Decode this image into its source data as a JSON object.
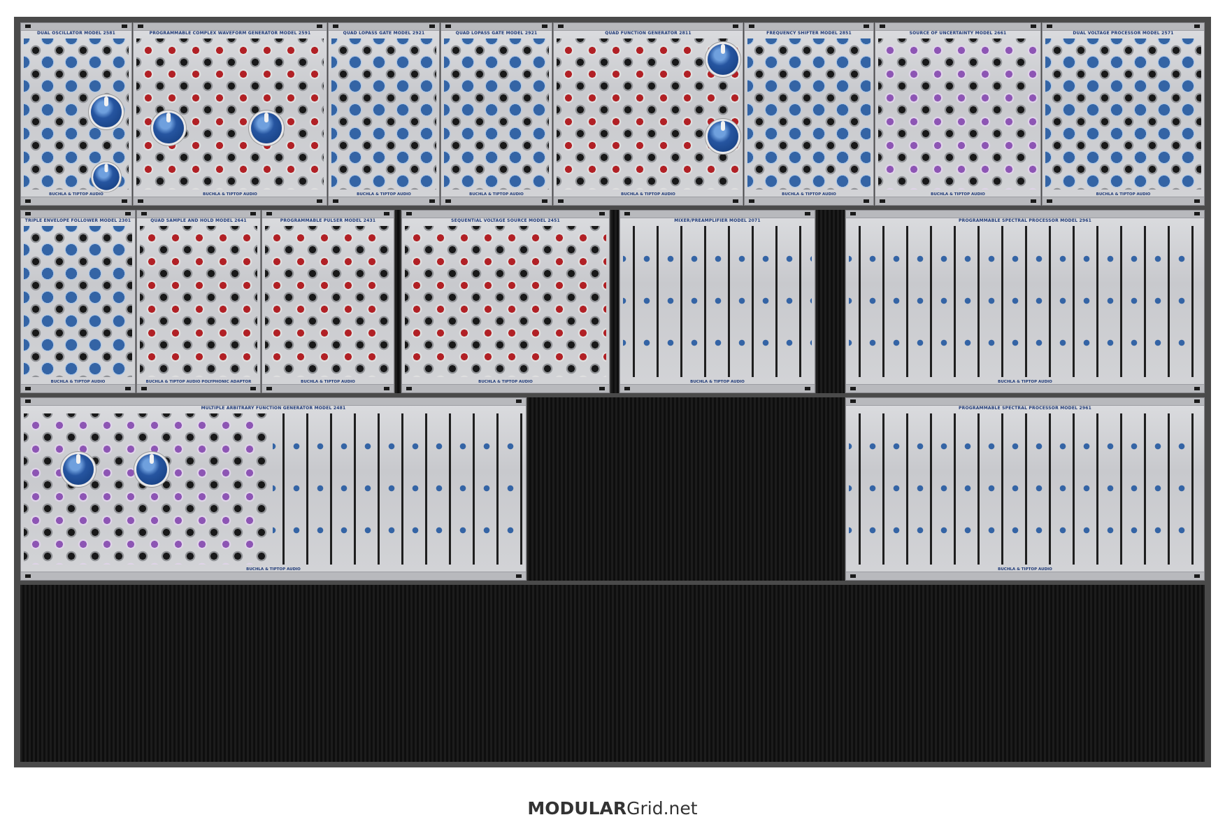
{
  "footer": {
    "brand_bold": "MODULAR",
    "brand_regular": "Grid.net"
  },
  "rows": [
    {
      "modules": [
        {
          "title": "DUAL OSCILLATOR MODEL 2581",
          "maker": "BUCHLA & TIPTOP AUDIO"
        },
        {
          "title": "PROGRAMMABLE COMPLEX WAVEFORM GENERATOR MODEL 2591",
          "maker": "BUCHLA & TIPTOP AUDIO"
        },
        {
          "title": "QUAD LOPASS GATE MODEL 2921",
          "maker": "BUCHLA & TIPTOP AUDIO"
        },
        {
          "title": "QUAD LOPASS GATE MODEL 2921",
          "maker": "BUCHLA & TIPTOP AUDIO"
        },
        {
          "title": "QUAD FUNCTION GENERATOR 2811",
          "maker": "BUCHLA & TIPTOP AUDIO"
        },
        {
          "title": "FREQUENCY SHIFTER MODEL 2851",
          "maker": "BUCHLA & TIPTOP AUDIO"
        },
        {
          "title": "SOURCE OF UNCERTAINTY MODEL 2661",
          "maker": "BUCHLA & TIPTOP AUDIO"
        },
        {
          "title": "DUAL VOLTAGE PROCESSOR MODEL 2571",
          "maker": "BUCHLA & TIPTOP AUDIO"
        }
      ]
    },
    {
      "modules": [
        {
          "title": "TRIPLE ENVELOPE FOLLOWER MODEL 2301",
          "maker": "BUCHLA & TIPTOP AUDIO"
        },
        {
          "title": "QUAD SAMPLE AND HOLD MODEL 2641",
          "maker": "BUCHLA & TIPTOP AUDIO POLYPHONIC ADAPTOR"
        },
        {
          "title": "PROGRAMMABLE PULSER MODEL 2431",
          "maker": "BUCHLA & TIPTOP AUDIO"
        },
        {
          "title": "SEQUENTIAL VOLTAGE SOURCE MODEL 2451",
          "maker": "BUCHLA & TIPTOP AUDIO"
        },
        {
          "title": "MIXER/PREAMPLIFIER MODEL 2071",
          "maker": "BUCHLA & TIPTOP AUDIO"
        },
        {
          "title": "PROGRAMMABLE SPECTRAL PROCESSOR MODEL 2961",
          "maker": "BUCHLA & TIPTOP AUDIO"
        }
      ]
    },
    {
      "modules": [
        {
          "title": "MULTIPLE ARBITRARY FUNCTION GENERATOR MODEL 2481",
          "maker": "BUCHLA & TIPTOP AUDIO"
        },
        {
          "title": "PROGRAMMABLE SPECTRAL PROCESSOR MODEL 2961",
          "maker": "BUCHLA & TIPTOP AUDIO"
        }
      ]
    }
  ]
}
